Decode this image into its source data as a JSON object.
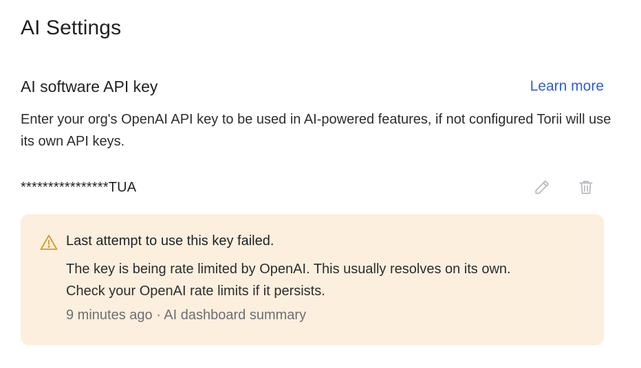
{
  "page": {
    "title": "AI Settings"
  },
  "api_key_section": {
    "title": "AI software API key",
    "learn_more_label": "Learn more",
    "description": "Enter your org's OpenAI API key to be used in AI-powered features, if not configured Torii will use its own API keys.",
    "masked_key": "****************TUA",
    "actions": {
      "edit_icon": "pencil-icon",
      "delete_icon": "trash-icon"
    }
  },
  "alert": {
    "icon": "warning-triangle-icon",
    "title": "Last attempt to use this key failed.",
    "message_line1": "The key is being rate limited by OpenAI. This usually resolves on its own.",
    "message_line2": "Check your OpenAI rate limits if it persists.",
    "meta": "9 minutes ago · AI dashboard summary"
  },
  "colors": {
    "link": "#2d5be3",
    "alert_background": "#fcefdd",
    "warning_icon": "#d9962b",
    "muted_text": "#6b6e75",
    "icon_gray": "#b5b7bc"
  }
}
